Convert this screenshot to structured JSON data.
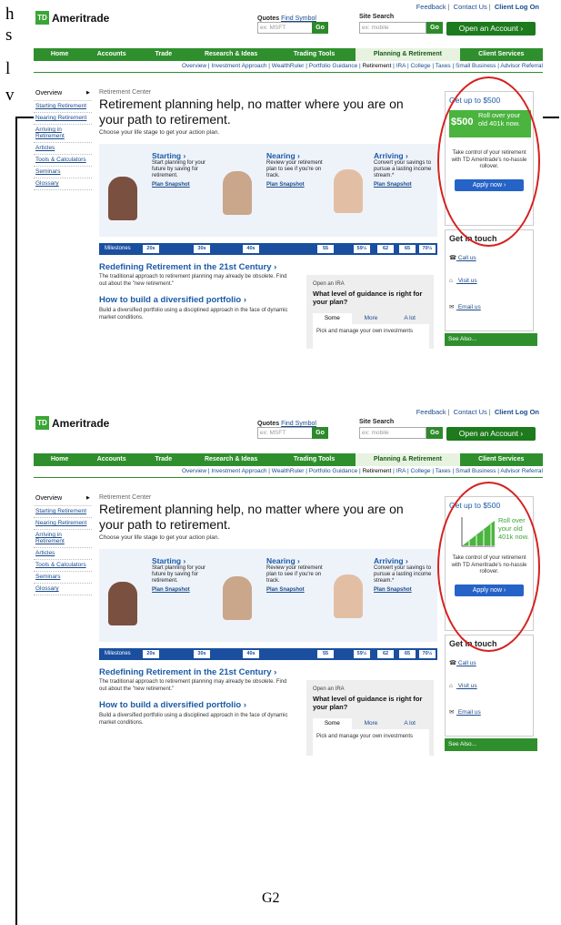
{
  "doc": {
    "line1": "h",
    "line2": "s",
    "line3": "l",
    "line4": "v",
    "caption": "G2"
  },
  "site": {
    "logo": "TD",
    "logo_name": "Ameritrade",
    "top_links": [
      "Feedback",
      "Contact Us",
      "Client Log On"
    ],
    "quotes_label": "Quotes",
    "find_symbol": "Find Symbol",
    "quotes_placeholder": "ex: MSFT",
    "site_search_label": "Site Search",
    "search_placeholder": "ex: mobile",
    "go": "Go",
    "open_account": "Open an Account ›",
    "nav": [
      "Home",
      "Accounts",
      "Trade",
      "Research & Ideas",
      "Trading Tools",
      "Planning & Retirement",
      "Client Services"
    ],
    "subnav": [
      "Overview",
      "Investment Approach",
      "WealthRuler",
      "Portfolio Guidance",
      "Retirement",
      "IRA",
      "College",
      "Taxes",
      "Small Business",
      "Advisor Referral"
    ],
    "leftnav_overview": "Overview",
    "leftnav": [
      "Starting Retirement",
      "Nearing Retirement",
      "Arriving in Retirement",
      "Articles",
      "Tools & Calculators",
      "Seminars",
      "Glossary"
    ],
    "rc_label": "Retirement Center",
    "rc_title": "Retirement planning help, no matter where you are on your path to retirement.",
    "rc_sub": "Choose your life stage to get your action plan.",
    "stages": [
      {
        "title": "Starting ›",
        "desc": "Start planning for your future by saving for retirement.",
        "link": "Plan Snapshot"
      },
      {
        "title": "Nearing ›",
        "desc": "Review your retirement plan to see if you're on track.",
        "link": "Plan Snapshot"
      },
      {
        "title": "Arriving ›",
        "desc": "Convert your savings to pursue a lasting income stream.*",
        "link": "Plan Snapshot"
      }
    ],
    "milestones_label": "Milestones",
    "milestones": [
      "20s",
      "30s",
      "40s",
      "55",
      "59½",
      "62",
      "65",
      "70½"
    ],
    "h1": "Redefining Retirement in the 21st Century ›",
    "p1": "The traditional approach to retirement planning may already be obsolete. Find out about the \"new retirement.\"",
    "h2": "How to build a diversified portfolio ›",
    "p2": "Build a diversified portfolio using a disciplined approach in the face of dynamic market conditions.",
    "ira_small": "Open an IRA",
    "ira_q": "What level of guidance is right for your plan?",
    "ira_tabs": [
      "Some",
      "More",
      "A lot"
    ],
    "ira_body": "Pick and manage your own investments",
    "promo_title": "Get up to $500",
    "promo_amount": "$500",
    "promo_roll": "Roll over your old 401k now.",
    "promo_desc": "Take control of your retirement with TD Ameritrade's no-hassle rollover.",
    "apply": "Apply now ›",
    "git_title": "Get in touch",
    "git_items": [
      "Call us",
      "Visit us",
      "Email us"
    ],
    "see_also": "See Also..."
  },
  "colors": {
    "brand_green": "#2f8f2d",
    "link_blue": "#1a4b8c",
    "highlight_red": "#d62020"
  }
}
